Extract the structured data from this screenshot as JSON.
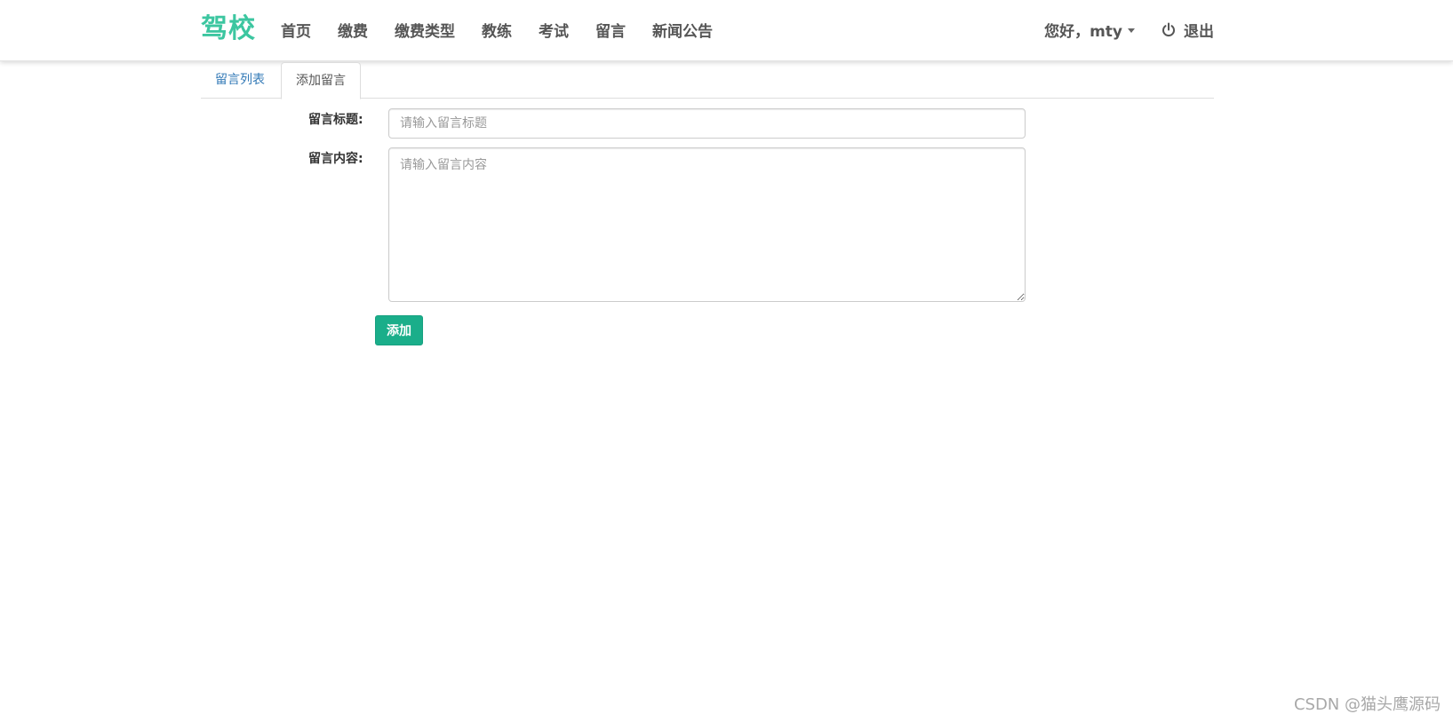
{
  "navbar": {
    "brand": "驾校",
    "links": [
      "首页",
      "缴费",
      "缴费类型",
      "教练",
      "考试",
      "留言",
      "新闻公告"
    ],
    "user_greeting": "您好，mty",
    "logout_label": "退出"
  },
  "tabs": {
    "list_label": "留言列表",
    "add_label": "添加留言",
    "active": "添加留言"
  },
  "form": {
    "title_label": "留言标题:",
    "title_value": "",
    "title_placeholder": "请输入留言标题",
    "content_label": "留言内容:",
    "content_value": "",
    "content_placeholder": "请输入留言内容",
    "submit_label": "添加"
  },
  "watermark": "CSDN @猫头鹰源码",
  "colors": {
    "brand": "#3cc6a0",
    "primary_button": "#1aae8a",
    "tab_link": "#337ab7"
  }
}
